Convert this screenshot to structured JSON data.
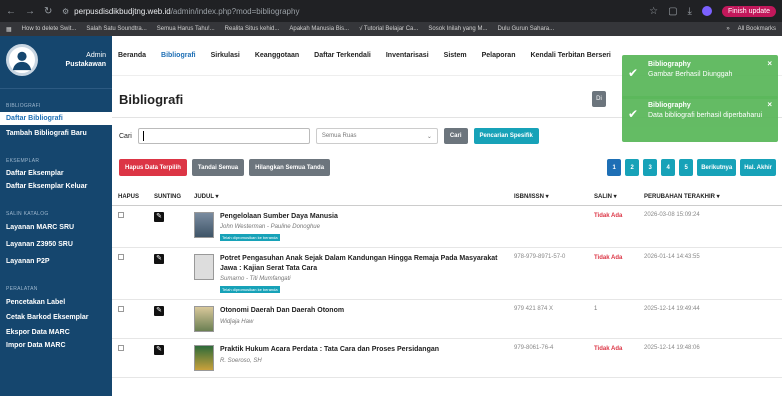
{
  "browser": {
    "url_domain": "perpusdisdikbudjtng.web.id",
    "url_path": "/admin/index.php?mod=bibliography",
    "finish_update_label": "Finish update",
    "bookmarks": [
      "How to delete Swit...",
      "Salah Satu Soundtra...",
      "Semua Harus Tahu!...",
      "Realita Situs kehid...",
      "Apakah Manusia Bis...",
      "√ Tutorial Belajar Ca...",
      "Sosok Inilah yang M...",
      "Dulu Gurun Sahara..."
    ],
    "all_bookmarks_label": "All Bookmarks"
  },
  "profile": {
    "name": "Admin",
    "role": "Pustakawan"
  },
  "sidebar": {
    "section_bibliografi": "BIBLIOGRAFI",
    "daftar_bibliografi": "Daftar Bibliografi",
    "tambah_bibliografi": "Tambah Bibliografi Baru",
    "section_eksemplar": "EKSEMPLAR",
    "daftar_eksemplar": "Daftar Eksemplar",
    "daftar_eksemplar_keluar": "Daftar Eksemplar Keluar",
    "section_salin": "SALIN KATALOG",
    "marc_sru": "Layanan MARC SRU",
    "z3950_sru": "Layanan Z3950 SRU",
    "p2p": "Layanan P2P",
    "section_peralatan": "PERALATAN",
    "cetak_label": "Pencetakan Label",
    "cetak_barkod": "Cetak Barkod Eksemplar",
    "ekspor_marc": "Ekspor Data MARC",
    "impor_marc": "Impor Data MARC"
  },
  "nav": [
    "Beranda",
    "Bibliografi",
    "Sirkulasi",
    "Keanggotaan",
    "Daftar Terkendali",
    "Inventarisasi",
    "Sistem",
    "Pelaporan",
    "Kendali Terbitan Berseri"
  ],
  "page": {
    "title": "Bibliografi",
    "drop_label": "Di",
    "search_label": "Cari",
    "search_value": "",
    "select_value": "Semua Ruas",
    "search_button": "Cari",
    "specific_search_button": "Pencarian Spesifik",
    "hapus_terpilih": "Hapus Data Terpilih",
    "tandai_semua": "Tandai Semua",
    "hilangkan_tanda": "Hilangkan Semua Tanda"
  },
  "pager": [
    "1",
    "2",
    "3",
    "4",
    "5",
    "Berikutnya",
    "Hal. Akhir"
  ],
  "table": {
    "headers": {
      "hapus": "HAPUS",
      "sunting": "SUNTING",
      "judul": "JUDUL ▾",
      "isbn": "ISBN/ISSN ▾",
      "salin": "SALIN ▾",
      "perubahan": "PERUBAHAN TERAKHIR ▾"
    },
    "rows": [
      {
        "title": "Pengelolaan Sumber Daya Manusia",
        "author": "John Westerman - Pauline Donoghue",
        "badge": "Telah dipromosikan ke beranda",
        "isbn": "",
        "salin": "Tidak Ada",
        "updated": "2026-03-08 15:09:24"
      },
      {
        "title": "Potret Pengasuhan Anak Sejak Dalam Kandungan Hingga Remaja Pada Masyarakat Jawa : Kajian Serat Tata Cara",
        "author": "Sumarno - Titi Mumfangati",
        "badge": "Telah dipromosikan ke beranda",
        "isbn": "978-979-8971-57-0",
        "salin": "Tidak Ada",
        "updated": "2026-01-14 14:43:55"
      },
      {
        "title": "Otonomi Daerah Dan Daerah Otonom",
        "author": "Widjaja Haw",
        "badge": "",
        "isbn": "979 421 874 X",
        "salin": "1",
        "updated": "2025-12-14 19:49:44"
      },
      {
        "title": "Praktik Hukum Acara Perdata : Tata Cara dan Proses Persidangan",
        "author": "R. Soeroso, SH",
        "badge": "",
        "isbn": "979-8061-76-4",
        "salin": "Tidak Ada",
        "updated": "2025-12-14 19:48:06"
      }
    ]
  },
  "toasts": [
    {
      "title": "Bibliography",
      "message": "Gambar Berhasil Diunggah"
    },
    {
      "title": "Bibliography",
      "message": "Data bibliografi berhasil diperbaharui"
    }
  ],
  "colors": {
    "sidebar": "#15466e",
    "accent": "#1e6fb5",
    "teal": "#17a2b8",
    "danger": "#dc3545",
    "success": "#5cb85c"
  }
}
